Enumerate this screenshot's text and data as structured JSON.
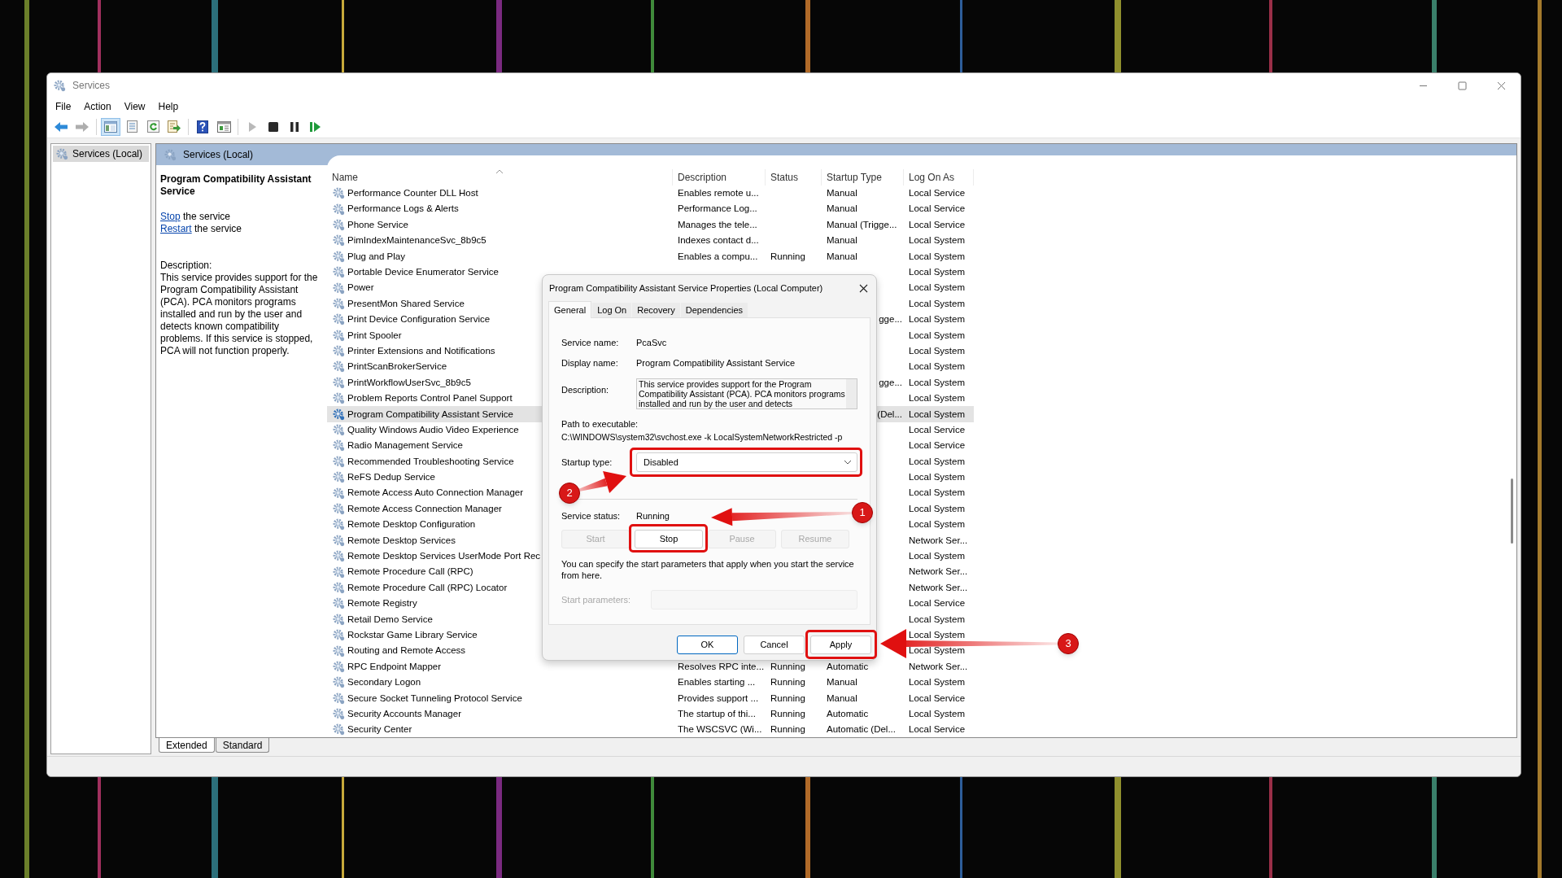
{
  "window": {
    "title": "Services"
  },
  "menu": [
    {
      "label": "File"
    },
    {
      "label": "Action"
    },
    {
      "label": "View"
    },
    {
      "label": "Help"
    }
  ],
  "toolbar": [
    [
      {
        "kind": "back",
        "pressed": false,
        "disabled": false
      },
      {
        "kind": "forward",
        "pressed": false,
        "disabled": true
      }
    ],
    [
      {
        "kind": "tree",
        "pressed": true,
        "disabled": false
      },
      {
        "kind": "properties",
        "pressed": false,
        "disabled": false
      },
      {
        "kind": "refresh",
        "pressed": false,
        "disabled": false
      },
      {
        "kind": "export",
        "pressed": false,
        "disabled": false
      }
    ],
    [
      {
        "kind": "help",
        "pressed": false,
        "disabled": false
      },
      {
        "kind": "console",
        "pressed": false,
        "disabled": false
      }
    ],
    [
      {
        "kind": "start",
        "pressed": false,
        "disabled": true
      },
      {
        "kind": "stop",
        "pressed": false,
        "disabled": false
      },
      {
        "kind": "pause",
        "pressed": false,
        "disabled": false
      },
      {
        "kind": "resume",
        "pressed": false,
        "disabled": false
      }
    ]
  ],
  "tree": [
    {
      "label": "Services (Local)",
      "selected": true
    }
  ],
  "pane_title": "Services (Local)",
  "detail": {
    "title": "Program Compatibility Assistant Service",
    "actions": [
      {
        "link": "Stop",
        "text": "the service"
      },
      {
        "link": "Restart",
        "text": "the service"
      }
    ],
    "description_label": "Description:",
    "description": "This service provides support for the Program Compatibility Assistant (PCA). PCA monitors programs installed and run by the user and detects known compatibility problems. If this service is stopped, PCA will not function properly."
  },
  "table": {
    "columns": [
      {
        "label": "Name",
        "sorted": true
      },
      {
        "label": "Description",
        "sorted": false
      },
      {
        "label": "Status",
        "sorted": false
      },
      {
        "label": "Startup Type",
        "sorted": false
      },
      {
        "label": "Log On As",
        "sorted": false
      }
    ],
    "rows": [
      {
        "name": "Performance Counter DLL Host",
        "description": "Enables remote u...",
        "startup_type": "Manual",
        "log_on_as": "Local Service",
        "selected": false
      },
      {
        "name": "Performance Logs & Alerts",
        "description": "Performance Log...",
        "startup_type": "Manual",
        "log_on_as": "Local Service",
        "selected": false
      },
      {
        "name": "Phone Service",
        "description": "Manages the tele...",
        "startup_type": "Manual (Trigge...",
        "log_on_as": "Local Service",
        "selected": false
      },
      {
        "name": "PimIndexMaintenanceSvc_8b9c5",
        "description": "Indexes contact d...",
        "startup_type": "Manual",
        "log_on_as": "Local System",
        "selected": false
      },
      {
        "name": "Plug and Play",
        "description": "Enables a compu...",
        "status": "Running",
        "startup_type": "Manual",
        "log_on_as": "Local System",
        "selected": false
      },
      {
        "name": "Portable Device Enumerator Service",
        "log_on_as": "Local System",
        "selected": false
      },
      {
        "name": "Power",
        "log_on_as": "Local System",
        "selected": false
      },
      {
        "name": "PresentMon Shared Service",
        "log_on_as": "Local System",
        "selected": false
      },
      {
        "name": "Print Device Configuration Service",
        "startup_type": "gge...",
        "startup_type_cut": true,
        "log_on_as": "Local System",
        "selected": false
      },
      {
        "name": "Print Spooler",
        "log_on_as": "Local System",
        "selected": false
      },
      {
        "name": "Printer Extensions and Notifications",
        "log_on_as": "Local System",
        "selected": false
      },
      {
        "name": "PrintScanBrokerService",
        "log_on_as": "Local System",
        "selected": false
      },
      {
        "name": "PrintWorkflowUserSvc_8b9c5",
        "startup_type": "gge...",
        "startup_type_cut": true,
        "log_on_as": "Local System",
        "selected": false
      },
      {
        "name": "Problem Reports Control Panel Support",
        "log_on_as": "Local System",
        "selected": false
      },
      {
        "name": "Program Compatibility Assistant Service",
        "startup_type": "(Del...",
        "startup_type_cut": true,
        "log_on_as": "Local System",
        "selected": true
      },
      {
        "name": "Quality Windows Audio Video Experience",
        "log_on_as": "Local Service",
        "selected": false
      },
      {
        "name": "Radio Management Service",
        "log_on_as": "Local Service",
        "selected": false
      },
      {
        "name": "Recommended Troubleshooting Service",
        "log_on_as": "Local System",
        "selected": false
      },
      {
        "name": "ReFS Dedup Service",
        "log_on_as": "Local System",
        "selected": false
      },
      {
        "name": "Remote Access Auto Connection Manager",
        "log_on_as": "Local System",
        "selected": false
      },
      {
        "name": "Remote Access Connection Manager",
        "log_on_as": "Local System",
        "selected": false
      },
      {
        "name": "Remote Desktop Configuration",
        "log_on_as": "Local System",
        "selected": false
      },
      {
        "name": "Remote Desktop Services",
        "log_on_as": "Network Ser...",
        "selected": false
      },
      {
        "name": "Remote Desktop Services UserMode Port Rec",
        "log_on_as": "Local System",
        "selected": false
      },
      {
        "name": "Remote Procedure Call (RPC)",
        "log_on_as": "Network Ser...",
        "selected": false
      },
      {
        "name": "Remote Procedure Call (RPC) Locator",
        "log_on_as": "Network Ser...",
        "selected": false
      },
      {
        "name": "Remote Registry",
        "log_on_as": "Local Service",
        "selected": false
      },
      {
        "name": "Retail Demo Service",
        "log_on_as": "Local System",
        "selected": false
      },
      {
        "name": "Rockstar Game Library Service",
        "log_on_as": "Local System",
        "selected": false
      },
      {
        "name": "Routing and Remote Access",
        "log_on_as": "Local System",
        "selected": false
      },
      {
        "name": "RPC Endpoint Mapper",
        "description": "Resolves RPC inte...",
        "status": "Running",
        "startup_type": "Automatic",
        "log_on_as": "Network Ser...",
        "selected": false
      },
      {
        "name": "Secondary Logon",
        "description": "Enables starting ...",
        "status": "Running",
        "startup_type": "Manual",
        "log_on_as": "Local System",
        "selected": false
      },
      {
        "name": "Secure Socket Tunneling Protocol Service",
        "description": "Provides support ...",
        "status": "Running",
        "startup_type": "Manual",
        "log_on_as": "Local Service",
        "selected": false
      },
      {
        "name": "Security Accounts Manager",
        "description": "The startup of thi...",
        "status": "Running",
        "startup_type": "Automatic",
        "log_on_as": "Local System",
        "selected": false
      },
      {
        "name": "Security Center",
        "description": "The WSCSVC (Wi...",
        "status": "Running",
        "startup_type": "Automatic (Del...",
        "log_on_as": "Local Service",
        "selected": false
      }
    ]
  },
  "view_tabs": [
    {
      "label": "Extended",
      "selected": true
    },
    {
      "label": "Standard",
      "selected": false
    }
  ],
  "dialog": {
    "title": "Program Compatibility Assistant Service Properties (Local Computer)",
    "tabs": [
      {
        "label": "General",
        "selected": true
      },
      {
        "label": "Log On",
        "selected": false
      },
      {
        "label": "Recovery",
        "selected": false
      },
      {
        "label": "Dependencies",
        "selected": false
      }
    ],
    "service_name_label": "Service name:",
    "service_name": "PcaSvc",
    "display_name_label": "Display name:",
    "display_name": "Program Compatibility Assistant Service",
    "description_label": "Description:",
    "description": "This service provides support for the Program Compatibility Assistant (PCA).  PCA monitors programs installed and run by the user and detects",
    "path_label": "Path to executable:",
    "path": "C:\\WINDOWS\\system32\\svchost.exe -k LocalSystemNetworkRestricted -p",
    "startup_type_label": "Startup type:",
    "startup_type": "Disabled",
    "status_label": "Service status:",
    "status": "Running",
    "service_buttons": [
      {
        "label": "Start",
        "disabled": true
      },
      {
        "label": "Stop",
        "disabled": false
      },
      {
        "label": "Pause",
        "disabled": true
      },
      {
        "label": "Resume",
        "disabled": true
      }
    ],
    "note": "You can specify the start parameters that apply when you start the service from here.",
    "start_parameters_label": "Start parameters:",
    "start_parameters_disabled": true,
    "buttons": [
      {
        "label": "OK",
        "default": true
      },
      {
        "label": "Cancel",
        "default": false
      },
      {
        "label": "Apply",
        "default": false
      }
    ]
  },
  "annotations": [
    {
      "number": "1"
    },
    {
      "number": "2"
    },
    {
      "number": "3"
    }
  ]
}
